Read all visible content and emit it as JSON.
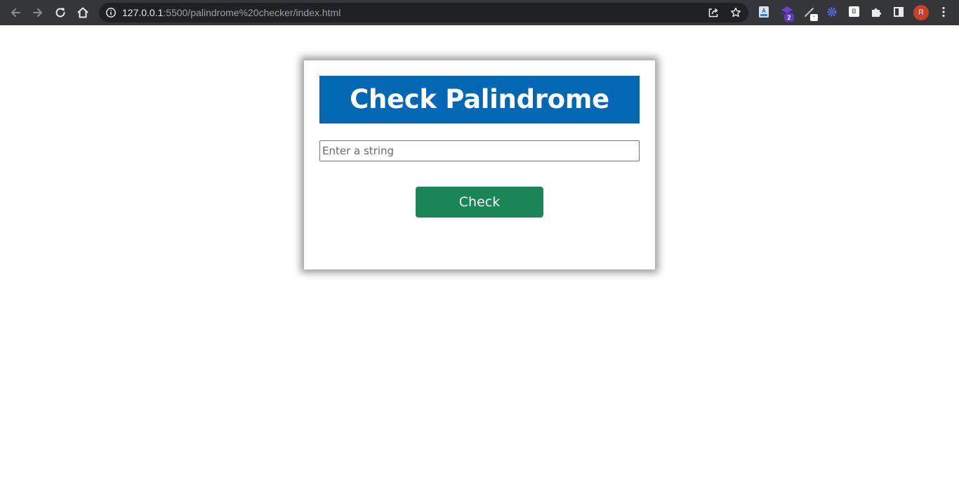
{
  "browser": {
    "url_host": "127.0.0.1",
    "url_rest": ":5500/palindrome%20checker/index.html",
    "extensions": {
      "badge_count": "2",
      "badge_small": "·",
      "b_label": "B"
    },
    "profile_initial": "R"
  },
  "page": {
    "title": "Check Palindrome",
    "input": {
      "placeholder": "Enter a string",
      "value": ""
    },
    "check_button_label": "Check"
  },
  "colors": {
    "title_bg": "#0268b3",
    "button_bg": "#1b8655",
    "toolbar_bg": "#35363a",
    "omnibox_bg": "#202124"
  },
  "icons": {
    "back": "arrow-left-icon",
    "forward": "arrow-right-icon",
    "reload": "reload-icon",
    "home": "home-icon",
    "info": "info-icon",
    "share": "share-icon",
    "bookmark": "star-icon",
    "extensions": "puzzle-icon",
    "side_panel": "side-panel-icon",
    "menu": "kebab-menu-icon"
  }
}
